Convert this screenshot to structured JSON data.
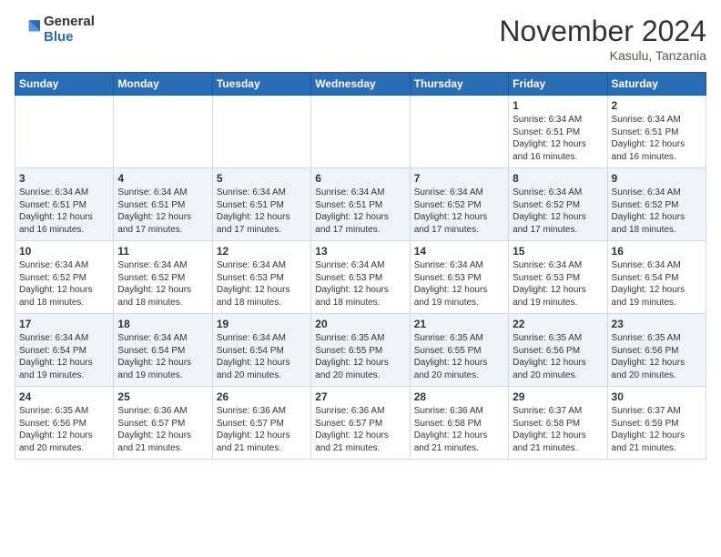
{
  "header": {
    "logo_general": "General",
    "logo_blue": "Blue",
    "month_title": "November 2024",
    "location": "Kasulu, Tanzania"
  },
  "days_of_week": [
    "Sunday",
    "Monday",
    "Tuesday",
    "Wednesday",
    "Thursday",
    "Friday",
    "Saturday"
  ],
  "weeks": [
    [
      {
        "day": "",
        "detail": ""
      },
      {
        "day": "",
        "detail": ""
      },
      {
        "day": "",
        "detail": ""
      },
      {
        "day": "",
        "detail": ""
      },
      {
        "day": "",
        "detail": ""
      },
      {
        "day": "1",
        "detail": "Sunrise: 6:34 AM\nSunset: 6:51 PM\nDaylight: 12 hours\nand 16 minutes."
      },
      {
        "day": "2",
        "detail": "Sunrise: 6:34 AM\nSunset: 6:51 PM\nDaylight: 12 hours\nand 16 minutes."
      }
    ],
    [
      {
        "day": "3",
        "detail": "Sunrise: 6:34 AM\nSunset: 6:51 PM\nDaylight: 12 hours\nand 16 minutes."
      },
      {
        "day": "4",
        "detail": "Sunrise: 6:34 AM\nSunset: 6:51 PM\nDaylight: 12 hours\nand 17 minutes."
      },
      {
        "day": "5",
        "detail": "Sunrise: 6:34 AM\nSunset: 6:51 PM\nDaylight: 12 hours\nand 17 minutes."
      },
      {
        "day": "6",
        "detail": "Sunrise: 6:34 AM\nSunset: 6:51 PM\nDaylight: 12 hours\nand 17 minutes."
      },
      {
        "day": "7",
        "detail": "Sunrise: 6:34 AM\nSunset: 6:52 PM\nDaylight: 12 hours\nand 17 minutes."
      },
      {
        "day": "8",
        "detail": "Sunrise: 6:34 AM\nSunset: 6:52 PM\nDaylight: 12 hours\nand 17 minutes."
      },
      {
        "day": "9",
        "detail": "Sunrise: 6:34 AM\nSunset: 6:52 PM\nDaylight: 12 hours\nand 18 minutes."
      }
    ],
    [
      {
        "day": "10",
        "detail": "Sunrise: 6:34 AM\nSunset: 6:52 PM\nDaylight: 12 hours\nand 18 minutes."
      },
      {
        "day": "11",
        "detail": "Sunrise: 6:34 AM\nSunset: 6:52 PM\nDaylight: 12 hours\nand 18 minutes."
      },
      {
        "day": "12",
        "detail": "Sunrise: 6:34 AM\nSunset: 6:53 PM\nDaylight: 12 hours\nand 18 minutes."
      },
      {
        "day": "13",
        "detail": "Sunrise: 6:34 AM\nSunset: 6:53 PM\nDaylight: 12 hours\nand 18 minutes."
      },
      {
        "day": "14",
        "detail": "Sunrise: 6:34 AM\nSunset: 6:53 PM\nDaylight: 12 hours\nand 19 minutes."
      },
      {
        "day": "15",
        "detail": "Sunrise: 6:34 AM\nSunset: 6:53 PM\nDaylight: 12 hours\nand 19 minutes."
      },
      {
        "day": "16",
        "detail": "Sunrise: 6:34 AM\nSunset: 6:54 PM\nDaylight: 12 hours\nand 19 minutes."
      }
    ],
    [
      {
        "day": "17",
        "detail": "Sunrise: 6:34 AM\nSunset: 6:54 PM\nDaylight: 12 hours\nand 19 minutes."
      },
      {
        "day": "18",
        "detail": "Sunrise: 6:34 AM\nSunset: 6:54 PM\nDaylight: 12 hours\nand 19 minutes."
      },
      {
        "day": "19",
        "detail": "Sunrise: 6:34 AM\nSunset: 6:54 PM\nDaylight: 12 hours\nand 20 minutes."
      },
      {
        "day": "20",
        "detail": "Sunrise: 6:35 AM\nSunset: 6:55 PM\nDaylight: 12 hours\nand 20 minutes."
      },
      {
        "day": "21",
        "detail": "Sunrise: 6:35 AM\nSunset: 6:55 PM\nDaylight: 12 hours\nand 20 minutes."
      },
      {
        "day": "22",
        "detail": "Sunrise: 6:35 AM\nSunset: 6:56 PM\nDaylight: 12 hours\nand 20 minutes."
      },
      {
        "day": "23",
        "detail": "Sunrise: 6:35 AM\nSunset: 6:56 PM\nDaylight: 12 hours\nand 20 minutes."
      }
    ],
    [
      {
        "day": "24",
        "detail": "Sunrise: 6:35 AM\nSunset: 6:56 PM\nDaylight: 12 hours\nand 20 minutes."
      },
      {
        "day": "25",
        "detail": "Sunrise: 6:36 AM\nSunset: 6:57 PM\nDaylight: 12 hours\nand 21 minutes."
      },
      {
        "day": "26",
        "detail": "Sunrise: 6:36 AM\nSunset: 6:57 PM\nDaylight: 12 hours\nand 21 minutes."
      },
      {
        "day": "27",
        "detail": "Sunrise: 6:36 AM\nSunset: 6:57 PM\nDaylight: 12 hours\nand 21 minutes."
      },
      {
        "day": "28",
        "detail": "Sunrise: 6:36 AM\nSunset: 6:58 PM\nDaylight: 12 hours\nand 21 minutes."
      },
      {
        "day": "29",
        "detail": "Sunrise: 6:37 AM\nSunset: 6:58 PM\nDaylight: 12 hours\nand 21 minutes."
      },
      {
        "day": "30",
        "detail": "Sunrise: 6:37 AM\nSunset: 6:59 PM\nDaylight: 12 hours\nand 21 minutes."
      }
    ]
  ]
}
